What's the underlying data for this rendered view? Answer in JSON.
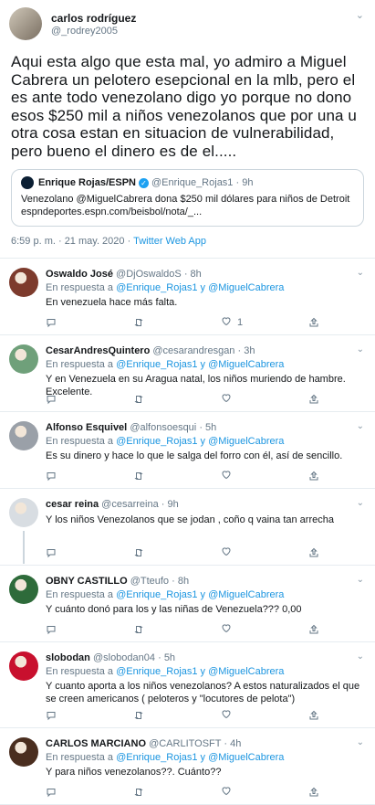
{
  "main_tweet": {
    "name": "carlos rodríguez",
    "handle": "@_rodrey2005",
    "text": "Aqui esta algo que esta mal, yo admiro a Miguel Cabrera un pelotero esepcional en la mlb, pero el es ante todo venezolano digo yo porque no dono esos $250 mil a niños venezolanos que por una u otra cosa estan en situacion de vulnerabilidad, pero bueno el dinero es de el.....",
    "quote": {
      "name": "Enrique Rojas/ESPN",
      "handle": "@Enrique_Rojas1",
      "time": "9h",
      "text": "Venezolano @MiguelCabrera dona $250 mil dólares para niños de Detroit espndeportes.espn.com/beisbol/nota/_..."
    },
    "timestamp": "6:59 p. m. · 21 may. 2020 · ",
    "source": "Twitter Web App"
  },
  "replying_to_label": "En respuesta a ",
  "replies": [
    {
      "name": "Oswaldo José",
      "handle": "@DjOswaldoS",
      "time": "8h",
      "mentions": "@Enrique_Rojas1 y @MiguelCabrera",
      "text": "En venezuela hace más falta.",
      "likes": "1",
      "avatar_color": "#7d3b2d"
    },
    {
      "name": "CesarAndresQuintero",
      "handle": "@cesarandresgan",
      "time": "3h",
      "mentions": "@Enrique_Rojas1 y @MiguelCabrera",
      "text": "Y en Venezuela en su Aragua natal, los niños muriendo de hambre. Excelente.",
      "likes": "",
      "avatar_color": "#6fa07a"
    },
    {
      "name": "Alfonso Esquivel",
      "handle": "@alfonsoesqui",
      "time": "5h",
      "mentions": "@Enrique_Rojas1 y @MiguelCabrera",
      "text": "Es su dinero y hace lo que le salga del forro con él, así de sencillo.",
      "likes": "",
      "avatar_color": "#9aa0a8"
    },
    {
      "name": "cesar reina",
      "handle": "@cesarreina",
      "time": "9h",
      "mentions": "",
      "text": "Y los niños Venezolanos que se jodan , coño q vaina tan arrecha",
      "likes": "",
      "avatar_color": "#d8dde2"
    },
    {
      "name": "OBNY CASTILLO",
      "handle": "@Tteufo",
      "time": "8h",
      "mentions": "@Enrique_Rojas1 y @MiguelCabrera",
      "text": "Y cuánto donó para los y las niñas de Venezuela??? 0,00",
      "likes": "",
      "avatar_color": "#2e6b3a"
    },
    {
      "name": "slobodan",
      "handle": "@slobodan04",
      "time": "5h",
      "mentions": "@Enrique_Rojas1 y @MiguelCabrera",
      "text": "Y cuanto aporta a los niños venezolanos? A estos naturalizados el que se creen americanos ( peloteros y \"locutores de pelota\")",
      "likes": "",
      "avatar_color": "#c8102e"
    },
    {
      "name": "CARLOS MARCIANO",
      "handle": "@CARLITOSFT",
      "time": "4h",
      "mentions": "@Enrique_Rojas1 y @MiguelCabrera",
      "text": "Y para niños venezolanos??. Cuánto??",
      "likes": "",
      "avatar_color": "#4a2e1f"
    }
  ]
}
